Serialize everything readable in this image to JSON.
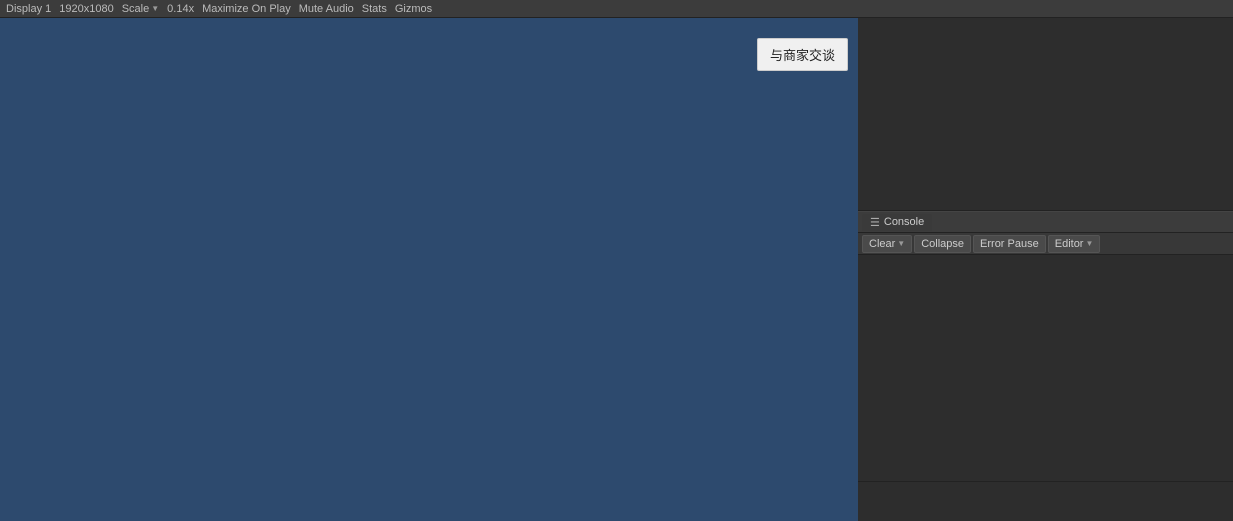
{
  "topbar": {
    "display_label": "Display 1",
    "resolution": "1920x1080",
    "scale_label": "Scale",
    "scale_value": "0.14x",
    "maximize_label": "Maximize On Play",
    "mute_label": "Mute Audio",
    "stats_label": "Stats",
    "gizmos_label": "Gizmos"
  },
  "gameview": {
    "popup_button_label": "与商家交谈"
  },
  "console": {
    "tab_label": "Console",
    "tab_icon": "☰",
    "toolbar": {
      "clear_label": "Clear",
      "collapse_label": "Collapse",
      "error_pause_label": "Error Pause",
      "editor_label": "Editor"
    }
  }
}
